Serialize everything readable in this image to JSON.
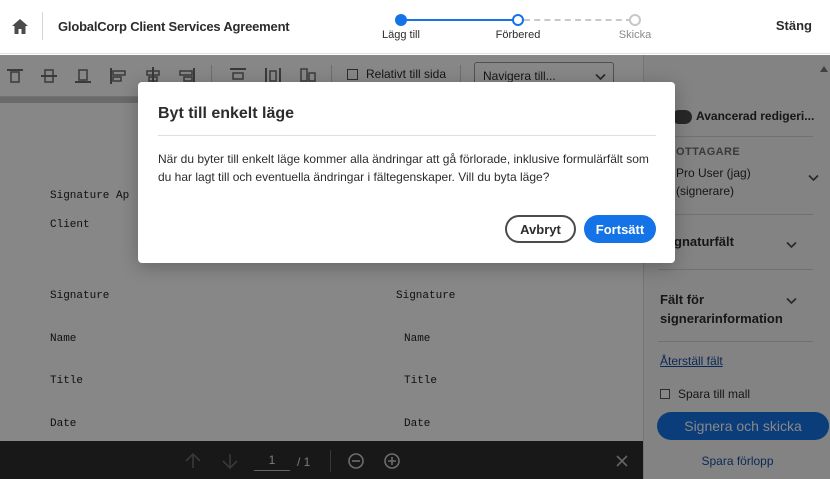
{
  "header": {
    "title": "GlobalCorp Client Services Agreement",
    "close_label": "Stäng",
    "steps": [
      {
        "label": "Lägg till",
        "state": "done"
      },
      {
        "label": "Förbered",
        "state": "current"
      },
      {
        "label": "Skicka",
        "state": "upcoming"
      }
    ]
  },
  "toolbar": {
    "relative_label": "Relativt till sida",
    "navigate_value": "Navigera till..."
  },
  "document": {
    "signature_heading": "Signature Ap",
    "client": "Client",
    "left_labels": [
      "Signature",
      "Name",
      "Title",
      "Date"
    ],
    "right_labels": [
      "Signature",
      "Name",
      "Title",
      "Date"
    ]
  },
  "bottom_bar": {
    "page_current": "1",
    "page_total": "/ 1"
  },
  "right_panel": {
    "advanced_label": "Avancerad redigeri...",
    "recipients_caps": "OTTAGARE",
    "recipient_line1": "Pro User (jag)",
    "recipient_line2": "(signerare)",
    "signature_fields": "gnaturfält",
    "signer_info_line1": "Fält för",
    "signer_info_line2": "signerarinformation",
    "reset_fields": "Återställ fält",
    "save_template": "Spara till mall",
    "sign_send": "Signera och skicka",
    "save_progress": "Spara förlopp"
  },
  "modal": {
    "title": "Byt till enkelt läge",
    "body": "När du byter till enkelt läge kommer alla ändringar att gå förlorade, inklusive formulärfält som du har lagt till och eventuella ändringar i fältegenskaper. Vill du byta läge?",
    "cancel": "Avbryt",
    "continue": "Fortsätt"
  },
  "colors": {
    "accent": "#1473e6",
    "link": "#1a4fa1",
    "overlay": "rgba(0,0,0,0.47)"
  }
}
